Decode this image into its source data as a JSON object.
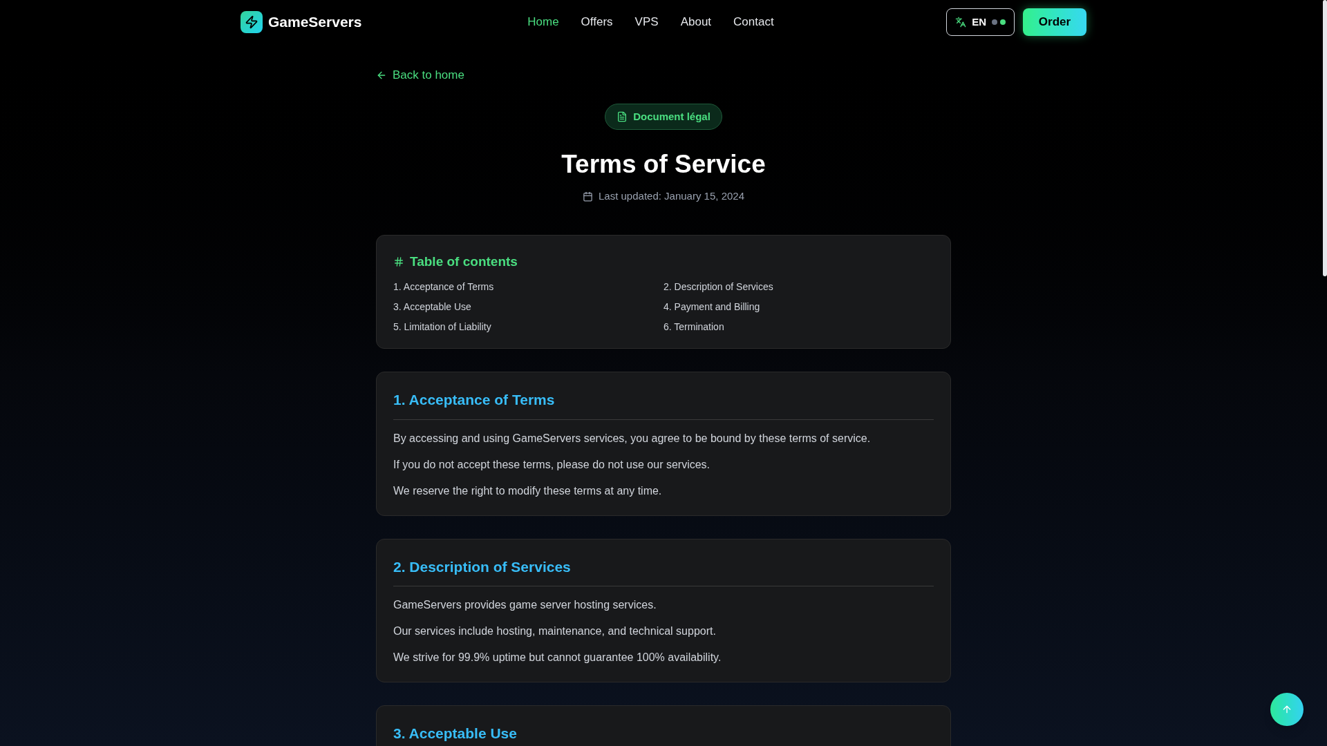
{
  "header": {
    "brand": "GameServers",
    "nav": [
      {
        "label": "Home",
        "selected": true
      },
      {
        "label": "Offers",
        "selected": false
      },
      {
        "label": "VPS",
        "selected": false
      },
      {
        "label": "About",
        "selected": false
      },
      {
        "label": "Contact",
        "selected": false
      }
    ],
    "language": "EN",
    "order_button": "Order"
  },
  "back_link": "Back to home",
  "badge": "Document légal",
  "title": "Terms of Service",
  "last_updated": "Last updated: January 15, 2024",
  "toc": {
    "title": "Table of contents",
    "items": [
      "1. Acceptance of Terms",
      "2. Description of Services",
      "3. Acceptable Use",
      "4. Payment and Billing",
      "5. Limitation of Liability",
      "6. Termination"
    ]
  },
  "sections": [
    {
      "heading": "1. Acceptance of Terms",
      "paragraphs": [
        "By accessing and using GameServers services, you agree to be bound by these terms of service.",
        "If you do not accept these terms, please do not use our services.",
        "We reserve the right to modify these terms at any time."
      ]
    },
    {
      "heading": "2. Description of Services",
      "paragraphs": [
        "GameServers provides game server hosting services.",
        "Our services include hosting, maintenance, and technical support.",
        "We strive for 99.9% uptime but cannot guarantee 100% availability."
      ]
    },
    {
      "heading": "3. Acceptable Use"
    }
  ]
}
